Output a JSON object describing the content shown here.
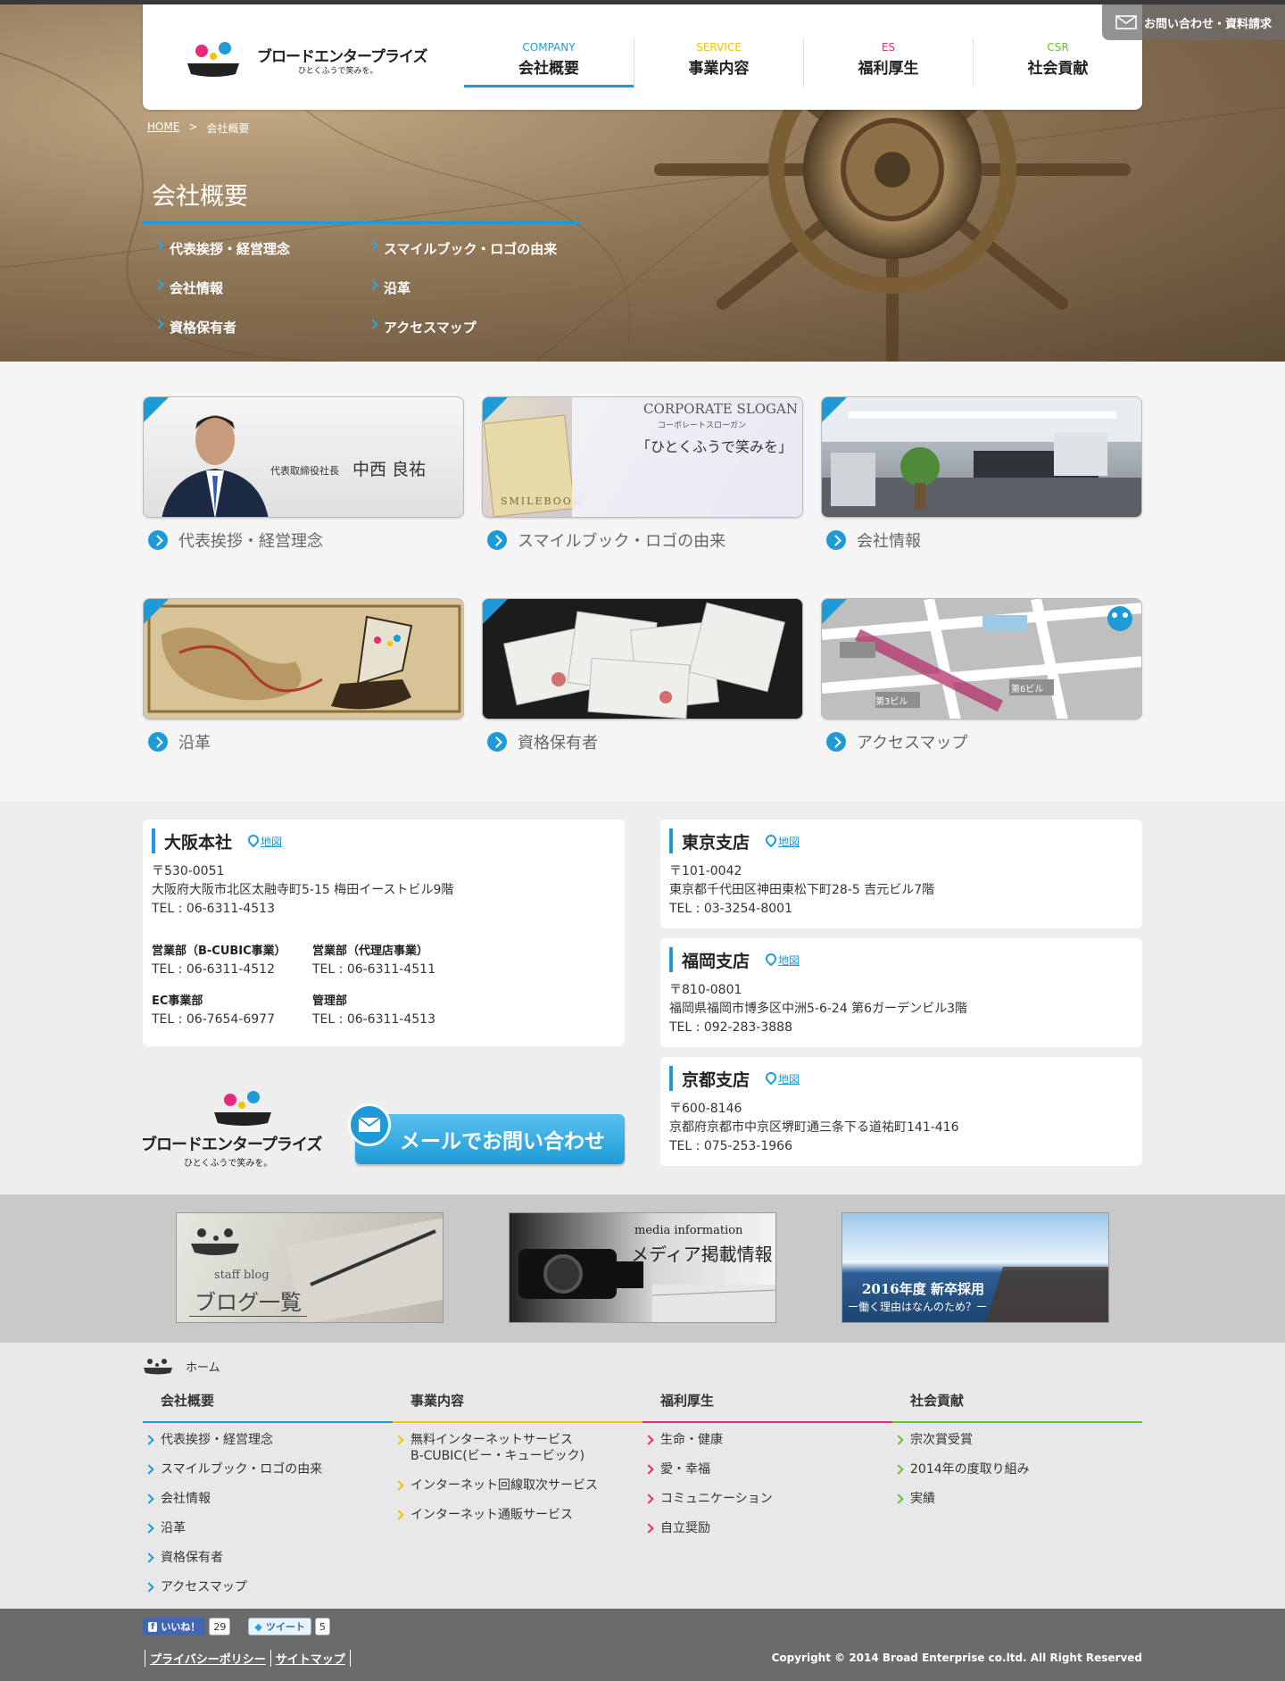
{
  "header": {
    "logo_text": "ブロードエンタープライズ",
    "logo_sub": "ひとくふうで笑みを。",
    "contact_label": "お問い合わせ・資料請求",
    "nav": [
      {
        "en": "COMPANY",
        "jp": "会社概要",
        "color": "#1e9bd7"
      },
      {
        "en": "SERVICE",
        "jp": "事業内容",
        "color": "#f2c400"
      },
      {
        "en": "ES",
        "jp": "福利厚生",
        "color": "#e6297b"
      },
      {
        "en": "CSR",
        "jp": "社会貢献",
        "color": "#6ac12d"
      }
    ]
  },
  "breadcrumb": {
    "home": "HOME",
    "sep": ">",
    "current": "会社概要"
  },
  "page_title": "会社概要",
  "sub_links": [
    "代表挨拶・経営理念",
    "スマイルブック・ロゴの由来",
    "会社情報",
    "沿革",
    "資格保有者",
    "アクセスマップ"
  ],
  "tiles": [
    {
      "label": "代表挨拶・経営理念",
      "caption_title": "代表取締役社長",
      "caption_name": "中西 良祐"
    },
    {
      "label": "スマイルブック・ロゴの由来",
      "caption_slogan": "CORPORATE SLOGAN",
      "caption_slogan_jp": "コーポレートスローガン",
      "caption_quote": "「ひとくふうで笑みを」",
      "caption_book": "SMILEBOOK"
    },
    {
      "label": "会社情報"
    },
    {
      "label": "沿革"
    },
    {
      "label": "資格保有者"
    },
    {
      "label": "アクセスマップ",
      "map_text": "第3ビル",
      "map_text2": "第6ビル"
    }
  ],
  "offices": {
    "map_label": "地図",
    "osaka": {
      "name": "大阪本社",
      "zip": "〒530-0051",
      "address": "大阪府大阪市北区太融寺町5-15 梅田イーストビル9階",
      "tel": "TEL : 06-6311-4513",
      "depts": [
        {
          "name": "営業部（B-CUBIC事業）",
          "tel": "TEL : 06-6311-4512"
        },
        {
          "name": "営業部（代理店事業）",
          "tel": "TEL : 06-6311-4511"
        },
        {
          "name": "EC事業部",
          "tel": "TEL : 06-7654-6977"
        },
        {
          "name": "管理部",
          "tel": "TEL : 06-6311-4513"
        }
      ]
    },
    "tokyo": {
      "name": "東京支店",
      "zip": "〒101-0042",
      "address": "東京都千代田区神田東松下町28-5 吉元ビル7階",
      "tel": "TEL : 03-3254-8001"
    },
    "fukuoka": {
      "name": "福岡支店",
      "zip": "〒810-0801",
      "address": "福岡県福岡市博多区中洲5-6-24 第6ガーデンビル3階",
      "tel": "TEL : 092-283-3888"
    },
    "kyoto": {
      "name": "京都支店",
      "zip": "〒600-8146",
      "address": "京都府京都市中京区堺町通三条下る道祐町141-416",
      "tel": "TEL : 075-253-1966"
    }
  },
  "mail_button": "メールでお問い合わせ",
  "banners": {
    "blog_en": "staff blog",
    "blog_jp": "ブログ一覧",
    "media_en": "media information",
    "media_jp": "メディア掲載情報",
    "recruit_title": "2016年度 新卒採用",
    "recruit_sub": "ー働く理由はなんのため？ー"
  },
  "footer": {
    "home": "ホーム",
    "cols": [
      {
        "head": "会社概要",
        "color": "#1e9bd7",
        "items": [
          "代表挨拶・経営理念",
          "スマイルブック・ロゴの由来",
          "会社情報",
          "沿革",
          "資格保有者",
          "アクセスマップ"
        ]
      },
      {
        "head": "事業内容",
        "color": "#f2c400",
        "items": [
          "無料インターネットサービス\nB-CUBIC(ビー・キュービック)",
          "インターネット回線取次サービス",
          "インターネット通販サービス"
        ]
      },
      {
        "head": "福利厚生",
        "color": "#e6297b",
        "items": [
          "生命・健康",
          "愛・幸福",
          "コミュニケーション",
          "自立奨励"
        ]
      },
      {
        "head": "社会貢献",
        "color": "#6ac12d",
        "items": [
          "宗次賞受賞",
          "2014年の度取り組み",
          "実績"
        ]
      }
    ],
    "like_label": "いいね！",
    "like_count": "29",
    "tweet_label": "ツイート",
    "tweet_count": "5",
    "privacy": "プライバシーポリシー",
    "sitemap": "サイトマップ",
    "copyright": "Copyright © 2014 Broad Enterprise co.ltd. All Right Reserved"
  }
}
